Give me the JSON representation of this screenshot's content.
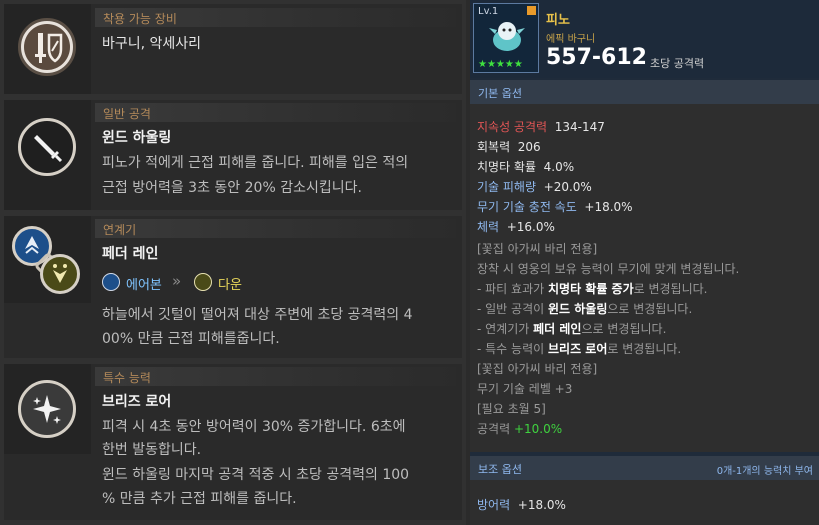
{
  "equip": {
    "header": "착용 가능 장비",
    "text": "바구니, 악세사리"
  },
  "basic": {
    "header": "일반 공격",
    "name": "윈드 하울링",
    "desc1": "피노가 적에게 근접 피해를 줍니다. 피해를 입은 적의",
    "desc2": "근접 방어력을 3초 동안 20% 감소시킵니다."
  },
  "chain": {
    "header": "연계기",
    "name": "페더 레인",
    "from": "에어본",
    "arrow": "»",
    "to": "다운",
    "desc1": "하늘에서 깃털이 떨어져 대상 주변에 초당 공격력의 4",
    "desc2": "00% 만큼 근접 피해를줍니다."
  },
  "special": {
    "header": "특수 능력",
    "name": "브리즈 로어",
    "desc1": "피격 시 4초 동안 방어력이 30% 증가합니다. 6초에",
    "desc2": "한번 발동합니다.",
    "desc3": "윈드 하울링 마지막 공격 적중 시 초당 공격력의 100",
    "desc4": "% 만큼 추가 근접 피해를 줍니다."
  },
  "item": {
    "level": "Lv.1",
    "name": "피노",
    "grade": "에픽 바구니",
    "damage": "557-612",
    "damage_unit": "초당 공격력",
    "stars": "★★★★★"
  },
  "base_options": {
    "header": "기본 옵션",
    "stats": [
      {
        "label": "지속성 공격력",
        "value": "134-147"
      },
      {
        "label": "회복력",
        "value": "206"
      },
      {
        "label": "치명타 확률",
        "value": "4.0%"
      },
      {
        "label": "기술 피해량",
        "value": "+20.0%"
      },
      {
        "label": "무기 기술 충전 속도",
        "value": "+18.0%"
      },
      {
        "label": "체력",
        "value": "+16.0%"
      }
    ],
    "notes": {
      "l1": "[꽃집 아가씨 바리 전용]",
      "l2": "장착 시 영웅의 보유 능력이 무기에 맞게 변경됩니다.",
      "l3a": "- 파티 효과가 ",
      "l3b": "치명타 확률 증가",
      "l3c": "로 변경됩니다.",
      "l4a": "- 일반 공격이 ",
      "l4b": "윈드 하울링",
      "l4c": "으로 변경됩니다.",
      "l5a": "- 연계기가 ",
      "l5b": "페더 레인",
      "l5c": "으로 변경됩니다.",
      "l6a": "- 특수 능력이 ",
      "l6b": "브리즈 로어",
      "l6c": "로 변경됩니다.",
      "l7": "[꽃집 아가씨 바리 전용]",
      "l8": "무기 기술 레벨 +3",
      "l9": "[필요 초월 5]",
      "l10a": "공격력 ",
      "l10b": "+10.0%"
    }
  },
  "sub_options": {
    "header": "보조 옵션",
    "hint": "0개-1개의 능력치 부여",
    "stat_label": "방어력",
    "stat_value": "+18.0%"
  },
  "colors": {
    "accent_blue": "#8fb8ee",
    "green": "#3fd23f",
    "red": "#e05555",
    "gold": "#e8c24a",
    "header_brown": "#b48a5a"
  }
}
